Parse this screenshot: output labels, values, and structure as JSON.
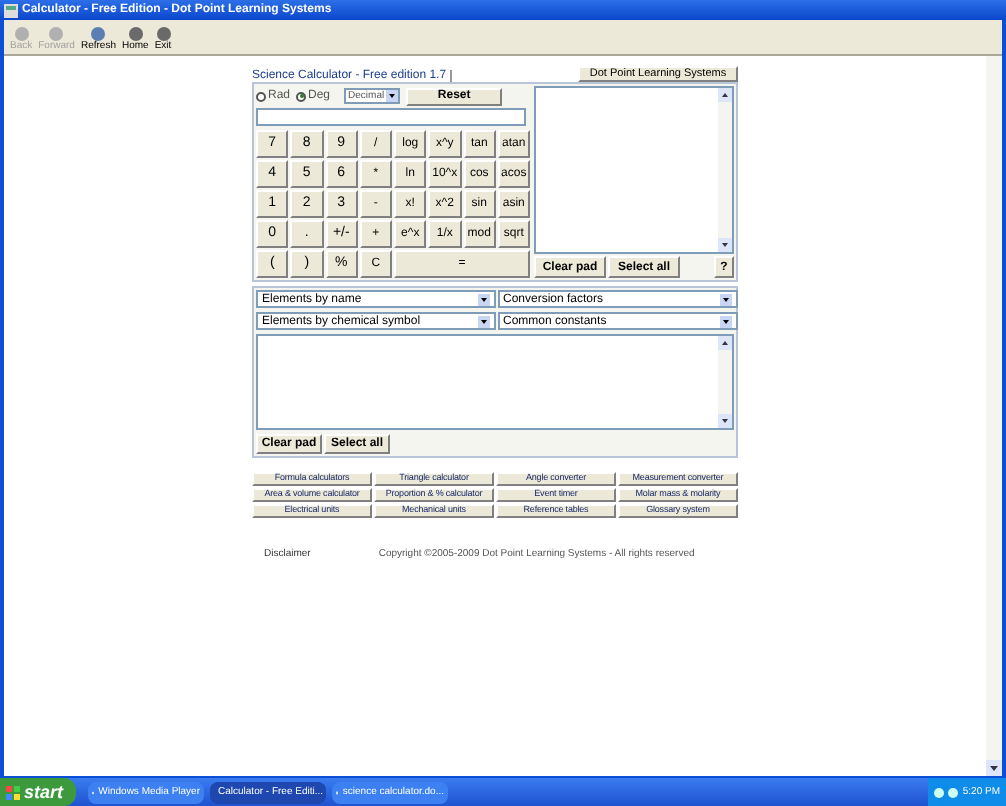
{
  "window": {
    "title": "Calculator - Free Edition - Dot Point Learning Systems"
  },
  "toolbar": [
    {
      "label": "Back",
      "disabled": true
    },
    {
      "label": "Forward",
      "disabled": true
    },
    {
      "label": "Refresh",
      "disabled": false
    },
    {
      "label": "Home",
      "disabled": false
    },
    {
      "label": "Exit",
      "disabled": false
    }
  ],
  "calculator": {
    "tab": "Science Calculator - Free edition 1.7",
    "brand_button": "Dot Point Learning Systems",
    "angle_modes": [
      {
        "label": "Rad",
        "selected": false
      },
      {
        "label": "Deg",
        "selected": true
      }
    ],
    "number_format": "Decimal",
    "reset": "Reset",
    "keys": [
      [
        "7",
        "8",
        "9",
        "/",
        "log",
        "x^y",
        "tan",
        "atan"
      ],
      [
        "4",
        "5",
        "6",
        "*",
        "ln",
        "10^x",
        "cos",
        "acos"
      ],
      [
        "1",
        "2",
        "3",
        "-",
        "x!",
        "x^2",
        "sin",
        "asin"
      ],
      [
        "0",
        ".",
        "+/-",
        "+",
        "e^x",
        "1/x",
        "mod",
        "sqrt"
      ],
      [
        "(",
        ")",
        "%",
        "C",
        "="
      ]
    ],
    "pad_buttons": [
      "Clear pad",
      "Select all",
      "?"
    ],
    "selects": [
      "Elements by name",
      "Conversion factors",
      "Elements by chemical symbol",
      "Common constants"
    ],
    "lower_pad_buttons": [
      "Clear pad",
      "Select all"
    ]
  },
  "links": [
    "Formula calculators",
    "Triangle calculator",
    "Angle converter",
    "Measurement converter",
    "Area & volume calculator",
    "Proportion & % calculator",
    "Event timer",
    "Molar mass & molarity",
    "Electrical units",
    "Mechanical units",
    "Reference tables",
    "Glossary system"
  ],
  "footer": {
    "disclaimer": "Disclaimer",
    "copyright": "Copyright ©2005-2009 Dot Point Learning Systems - All rights reserved"
  },
  "taskbar": {
    "start": "start",
    "tasks": [
      {
        "label": "Windows Media Player",
        "selected": false
      },
      {
        "label": "Calculator - Free Editi...",
        "selected": true
      },
      {
        "label": "science calculator.do...",
        "selected": false
      }
    ],
    "clock": "5:20 PM"
  }
}
